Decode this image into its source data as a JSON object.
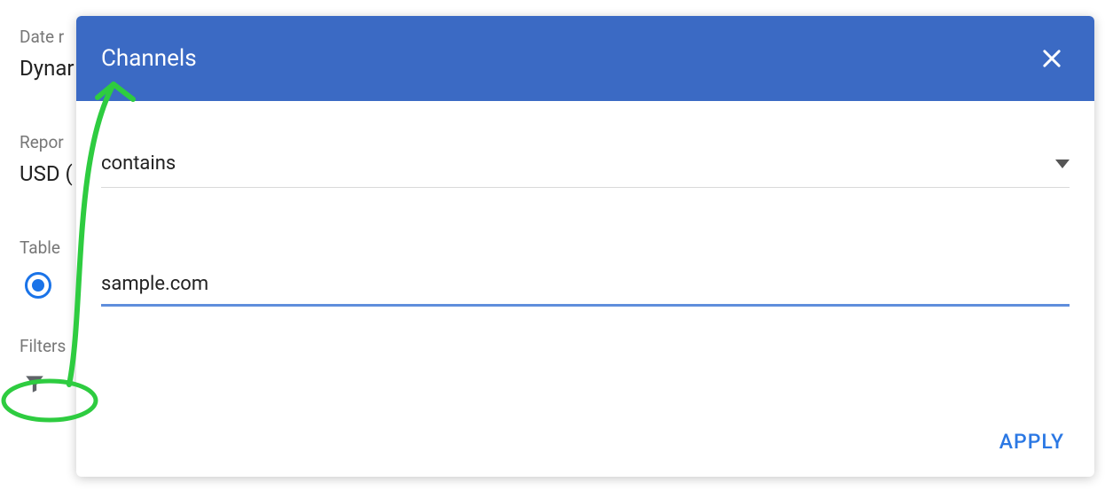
{
  "sidebar": {
    "date_label": "Date r",
    "date_value": "Dynar",
    "report_label": "Repor",
    "report_value": "USD (",
    "table_label": "Table",
    "filters_label": "Filters"
  },
  "modal": {
    "title": "Channels",
    "condition": "contains",
    "input_value": "sample.com",
    "apply_label": "APPLY"
  },
  "colors": {
    "header_blue": "#3b6ac4",
    "accent_blue": "#2b78e4",
    "underline_blue": "#5f8edc",
    "annotation_green": "#33cc33"
  }
}
